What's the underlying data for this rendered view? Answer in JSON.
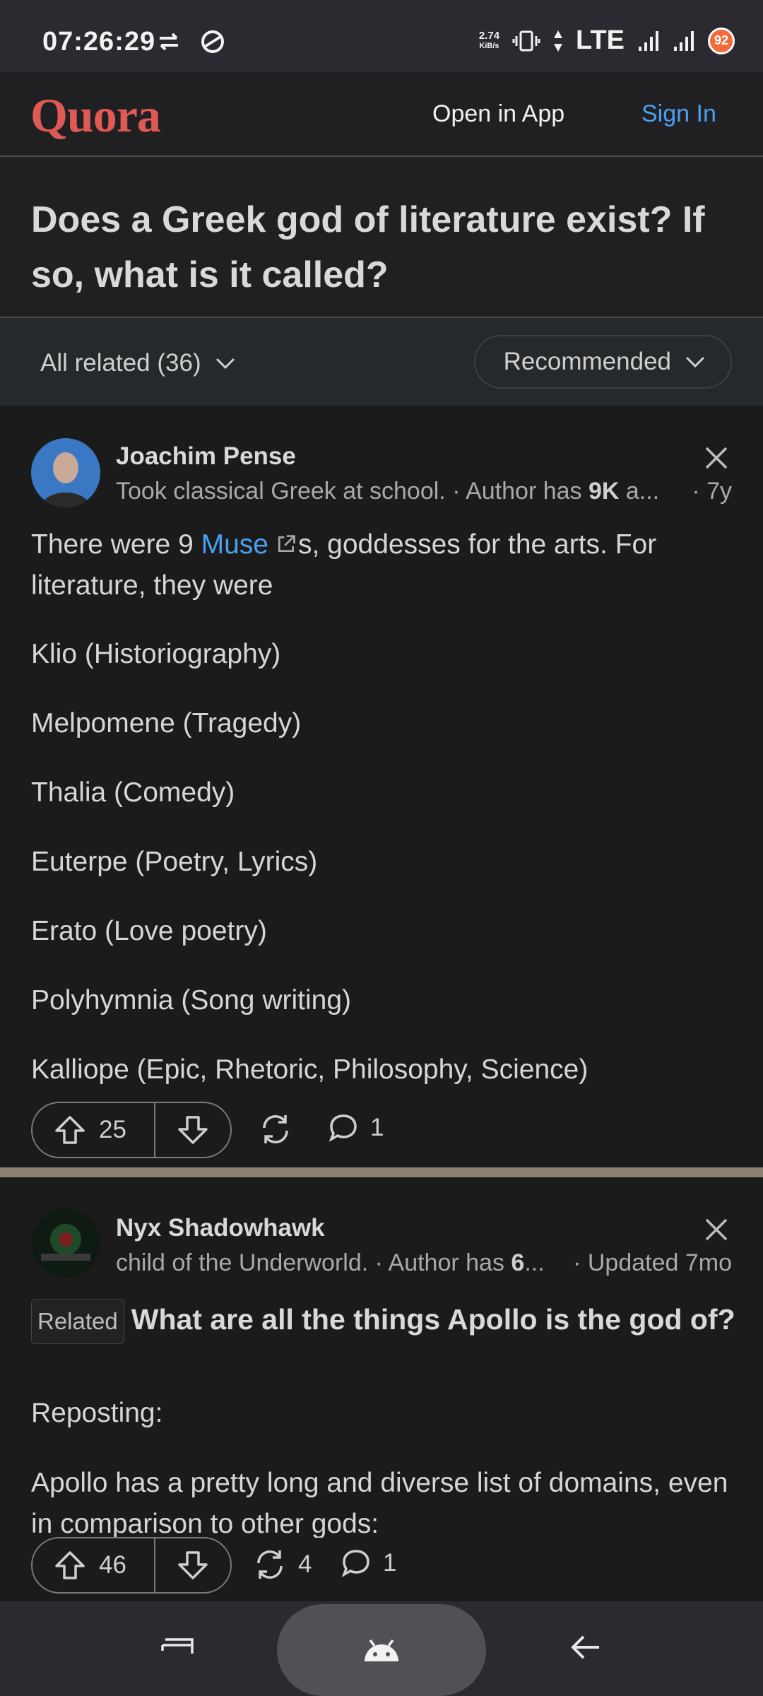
{
  "status_bar": {
    "time": "07:26:29",
    "speed_value": "2.74",
    "speed_unit": "KiB/s",
    "network": "LTE",
    "battery": "92"
  },
  "header": {
    "logo": "Quora",
    "open_in_app": "Open in App",
    "sign_in": "Sign In"
  },
  "question": {
    "title": "Does a Greek god of literature exist? If so, what is it called?"
  },
  "filters": {
    "all_related": "All related (36)",
    "sort": "Recommended"
  },
  "answers": [
    {
      "author": "Joachim Pense",
      "credential_prefix": "Took classical Greek at school. · Author has ",
      "credential_bold": "9K",
      "credential_suffix": " a...",
      "age": "· 7y",
      "intro_before": "There were 9 ",
      "intro_link": "Muse",
      "intro_after": "s, goddesses for the arts. For literature, they were",
      "items": [
        "Klio (Historiography)",
        "Melpomene (Tragedy)",
        "Thalia (Comedy)",
        "Euterpe (Poetry, Lyrics)",
        "Erato (Love poetry)",
        "Polyhymnia (Song writing)",
        "Kalliope (Epic, Rhetoric, Philosophy, Science)"
      ],
      "upvotes": "25",
      "shares": "",
      "comments": "1"
    },
    {
      "author": "Nyx Shadowhawk",
      "credential_prefix": "child of the Underworld. · Author has ",
      "credential_bold": "6",
      "credential_suffix": "...",
      "age": "· Updated 7mo",
      "related_tag": "Related",
      "related_question": "What are all the things Apollo is the god of?",
      "line1": "Reposting:",
      "line2": "Apollo has a pretty long and diverse list of domains, even in comparison to other gods:",
      "upvotes": "46",
      "shares": "4",
      "comments": "1"
    }
  ],
  "colors": {
    "brand": "#e05a55",
    "link": "#4ba0f0",
    "background": "#1b1b1b"
  }
}
